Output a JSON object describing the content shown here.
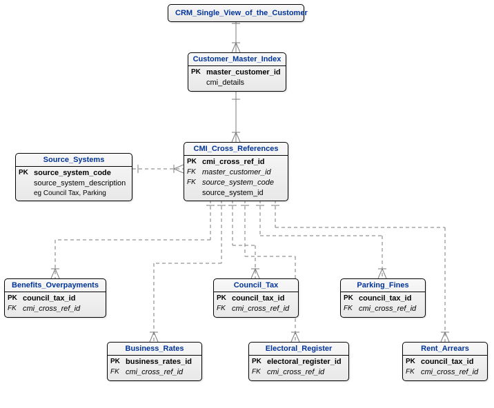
{
  "diagram": {
    "type": "ER-diagram",
    "title": "CRM Single View of the Customer",
    "entities": {
      "crm": {
        "name": "CRM_Single_View_of_the_Customer",
        "attrs": []
      },
      "cmi": {
        "name": "Customer_Master_Index",
        "attrs": [
          {
            "key": "PK",
            "label": "master_customer_id"
          },
          {
            "key": "",
            "label": "cmi_details"
          }
        ]
      },
      "src": {
        "name": "Source_Systems",
        "attrs": [
          {
            "key": "PK",
            "label": "source_system_code"
          },
          {
            "key": "",
            "label": "source_system_description"
          },
          {
            "key": "",
            "label": "eg Council Tax, Parking",
            "eg": true
          }
        ]
      },
      "xref": {
        "name": "CMI_Cross_References",
        "attrs": [
          {
            "key": "PK",
            "label": "cmi_cross_ref_id"
          },
          {
            "key": "FK",
            "label": "master_customer_id"
          },
          {
            "key": "FK",
            "label": "source_system_code"
          },
          {
            "key": "",
            "label": "source_system_id"
          }
        ]
      },
      "benefits": {
        "name": "Benefits_Overpayments",
        "attrs": [
          {
            "key": "PK",
            "label": "council_tax_id"
          },
          {
            "key": "FK",
            "label": "cmi_cross_ref_id"
          }
        ]
      },
      "council": {
        "name": "Council_Tax",
        "attrs": [
          {
            "key": "PK",
            "label": "council_tax_id"
          },
          {
            "key": "FK",
            "label": "cmi_cross_ref_id"
          }
        ]
      },
      "parking": {
        "name": "Parking_Fines",
        "attrs": [
          {
            "key": "PK",
            "label": "council_tax_id"
          },
          {
            "key": "FK",
            "label": "cmi_cross_ref_id"
          }
        ]
      },
      "business": {
        "name": "Business_Rates",
        "attrs": [
          {
            "key": "PK",
            "label": "business_rates_id"
          },
          {
            "key": "FK",
            "label": "cmi_cross_ref_id"
          }
        ]
      },
      "electoral": {
        "name": "Electoral_Register",
        "attrs": [
          {
            "key": "PK",
            "label": "electoral_register_id"
          },
          {
            "key": "FK",
            "label": "cmi_cross_ref_id"
          }
        ]
      },
      "rent": {
        "name": "Rent_Arrears",
        "attrs": [
          {
            "key": "PK",
            "label": "council_tax_id"
          },
          {
            "key": "FK",
            "label": "cmi_cross_ref_id"
          }
        ]
      }
    },
    "relationships": [
      {
        "from": "crm",
        "to": "cmi",
        "type": "one-to-many",
        "style": "solid"
      },
      {
        "from": "cmi",
        "to": "xref",
        "type": "one-to-many",
        "style": "solid"
      },
      {
        "from": "src",
        "to": "xref",
        "type": "one-to-many",
        "style": "dashed"
      },
      {
        "from": "xref",
        "to": "benefits",
        "type": "one-to-many",
        "style": "dashed"
      },
      {
        "from": "xref",
        "to": "council",
        "type": "one-to-many",
        "style": "dashed"
      },
      {
        "from": "xref",
        "to": "parking",
        "type": "one-to-many",
        "style": "dashed"
      },
      {
        "from": "xref",
        "to": "business",
        "type": "one-to-many",
        "style": "dashed"
      },
      {
        "from": "xref",
        "to": "electoral",
        "type": "one-to-many",
        "style": "dashed"
      },
      {
        "from": "xref",
        "to": "rent",
        "type": "one-to-many",
        "style": "dashed"
      }
    ]
  }
}
